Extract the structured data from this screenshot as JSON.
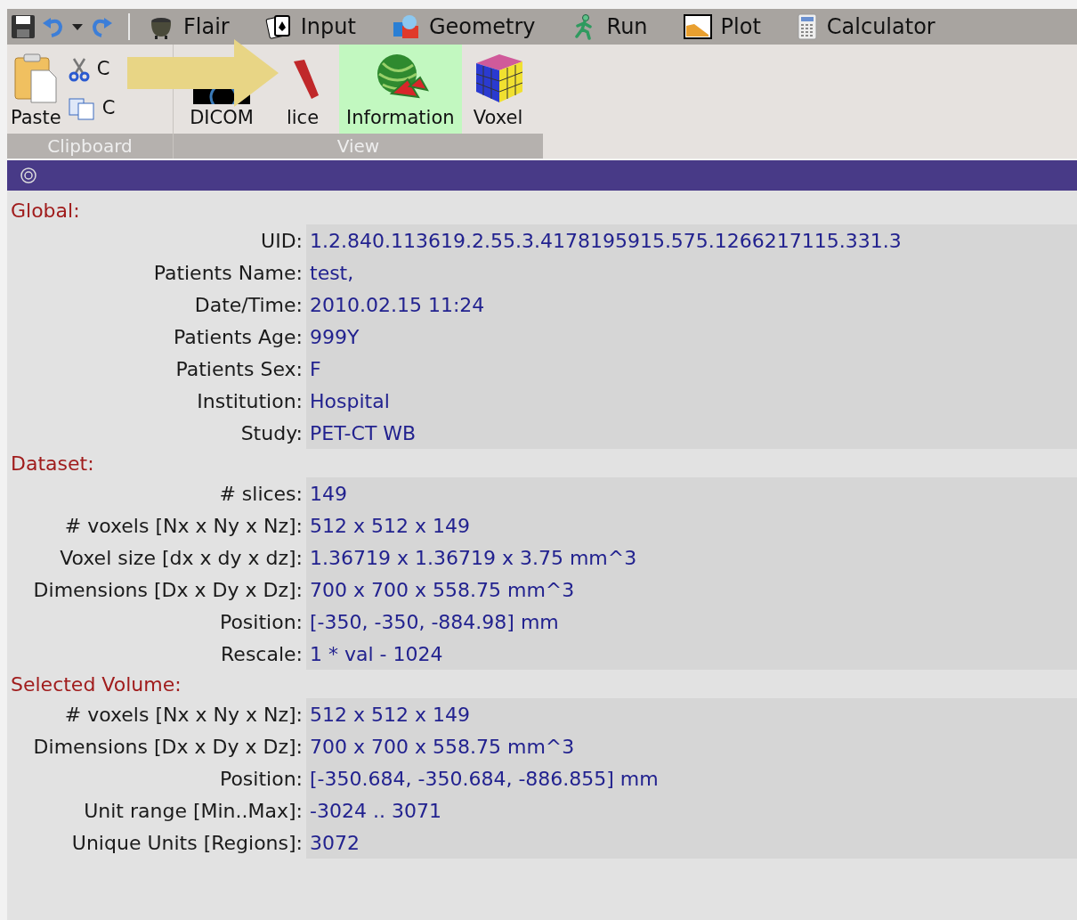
{
  "tabs": [
    {
      "label": "Flair",
      "kind": "pot"
    },
    {
      "label": "Input",
      "kind": "cards"
    },
    {
      "label": "Geometry",
      "kind": "shapes"
    },
    {
      "label": "Run",
      "kind": "runner"
    },
    {
      "label": "Plot",
      "kind": "plot"
    },
    {
      "label": "Calculator",
      "kind": "calculator"
    }
  ],
  "ribbon": {
    "groups": [
      {
        "label": "Clipboard",
        "paste": {
          "label": "Paste"
        },
        "small_buttons": [
          {
            "label": "C",
            "kind": "cut"
          },
          {
            "label": "C",
            "kind": "copy"
          }
        ]
      },
      {
        "label": "View",
        "buttons": [
          {
            "label": "DICOM",
            "kind": "dicom",
            "selected": false
          },
          {
            "label": "lice",
            "kind": "slice",
            "selected": false
          },
          {
            "label": "Information",
            "kind": "melon",
            "selected": true
          },
          {
            "label": "Voxel",
            "kind": "cube",
            "selected": false
          }
        ]
      }
    ]
  },
  "sections": [
    {
      "title": "Global:",
      "rows": [
        {
          "label": "UID:",
          "value": "1.2.840.113619.2.55.3.4178195915.575.1266217115.331.3"
        },
        {
          "label": "Patients Name:",
          "value": "test,"
        },
        {
          "label": "Date/Time:",
          "value": "2010.02.15 11:24"
        },
        {
          "label": "Patients Age:",
          "value": "999Y"
        },
        {
          "label": "Patients Sex:",
          "value": "F"
        },
        {
          "label": "Institution:",
          "value": "Hospital"
        },
        {
          "label": "Study:",
          "value": "PET-CT WB"
        }
      ]
    },
    {
      "title": "Dataset:",
      "rows": [
        {
          "label": "# slices:",
          "value": "149"
        },
        {
          "label": "# voxels [Nx x Ny x Nz]:",
          "value": "512 x 512 x 149"
        },
        {
          "label": "Voxel size [dx x dy x dz]:",
          "value": "1.36719 x 1.36719 x 3.75 mm^3"
        },
        {
          "label": "Dimensions [Dx x Dy x Dz]:",
          "value": "700 x 700 x 558.75 mm^3"
        },
        {
          "label": "Position:",
          "value": "[-350, -350, -884.98] mm"
        },
        {
          "label": "Rescale:",
          "value": "1 * val - 1024"
        }
      ]
    },
    {
      "title": "Selected Volume:",
      "rows": [
        {
          "label": "# voxels [Nx x Ny x Nz]:",
          "value": "512 x 512 x 149"
        },
        {
          "label": "Dimensions [Dx x Dy x Dz]:",
          "value": "700 x 700 x 558.75 mm^3"
        },
        {
          "label": "Position:",
          "value": "[-350.684, -350.684, -886.855] mm"
        },
        {
          "label": "Unit range [Min..Max]:",
          "value": "-3024 .. 3071"
        },
        {
          "label": "Unique Units [Regions]:",
          "value": "3072"
        }
      ]
    }
  ]
}
